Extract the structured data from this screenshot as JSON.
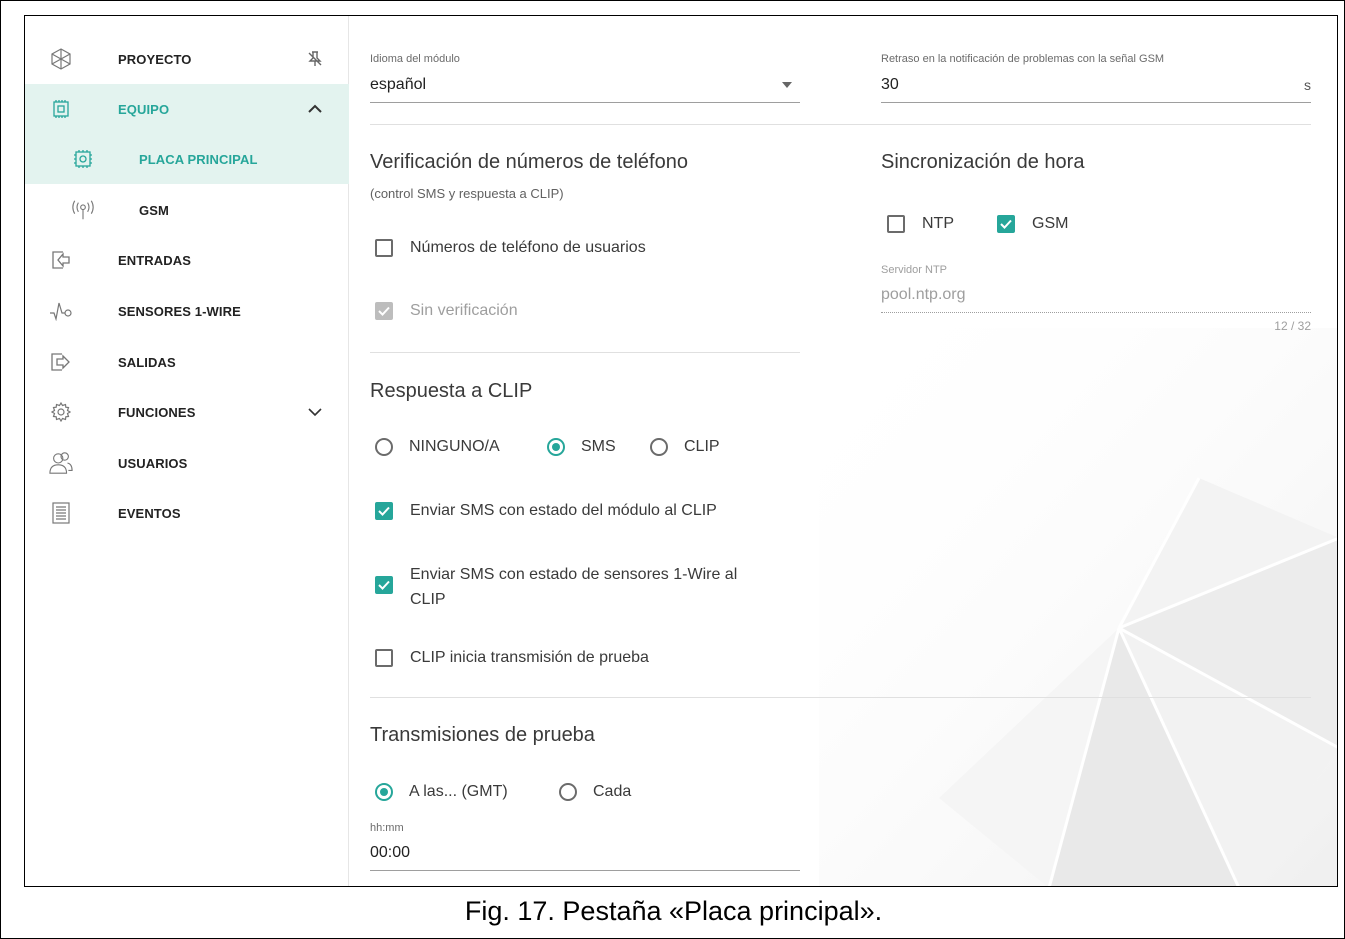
{
  "sidebar": {
    "items": [
      {
        "label": "PROYECTO",
        "icon": "project-icon",
        "trail": "pin-off-icon"
      },
      {
        "label": "EQUIPO",
        "icon": "chip-icon",
        "trail": "chevron-up-icon"
      },
      {
        "label": "PLACA PRINCIPAL",
        "icon": "board-icon"
      },
      {
        "label": "GSM",
        "icon": "antenna-icon"
      },
      {
        "label": "ENTRADAS",
        "icon": "input-icon"
      },
      {
        "label": "SENSORES 1-WIRE",
        "icon": "sensor-icon"
      },
      {
        "label": "SALIDAS",
        "icon": "output-icon"
      },
      {
        "label": "FUNCIONES",
        "icon": "gear-icon",
        "trail": "chevron-down-icon"
      },
      {
        "label": "USUARIOS",
        "icon": "users-icon"
      },
      {
        "label": "EVENTOS",
        "icon": "log-icon"
      }
    ]
  },
  "main": {
    "language": {
      "label": "Idioma del módulo",
      "value": "español"
    },
    "gsm_delay": {
      "label": "Retraso en la notificación de problemas con la señal GSM",
      "value": "30",
      "unit": "s"
    },
    "verification": {
      "title": "Verificación de números de teléfono",
      "subtitle": "(control SMS y respuesta a CLIP)",
      "user_numbers": "Números de teléfono de usuarios",
      "no_verification": "Sin verificación"
    },
    "clip": {
      "title": "Respuesta a CLIP",
      "radio_none": "NINGUNO/A",
      "radio_sms": "SMS",
      "radio_clip": "CLIP",
      "send_state": "Enviar SMS con estado del módulo al CLIP",
      "send_sensors_line1": "Enviar SMS con estado de sensores 1-Wire al",
      "send_sensors_line2": "CLIP",
      "test_transmission": "CLIP inicia transmisión de prueba"
    },
    "tests": {
      "title": "Transmisiones de prueba",
      "radio_at": "A las... (GMT)",
      "radio_every": "Cada",
      "time_label": "hh:mm",
      "time_value": "00:00"
    },
    "sync": {
      "title": "Sincronización de hora",
      "ntp": "NTP",
      "gsm": "GSM",
      "server_label": "Servidor NTP",
      "server_value": "pool.ntp.org",
      "counter": "12 / 32"
    }
  },
  "colors": {
    "accent": "#26a69a",
    "active_bg": "#e3f3ef"
  },
  "caption": "Fig. 17. Pestaña «Placa principal»."
}
